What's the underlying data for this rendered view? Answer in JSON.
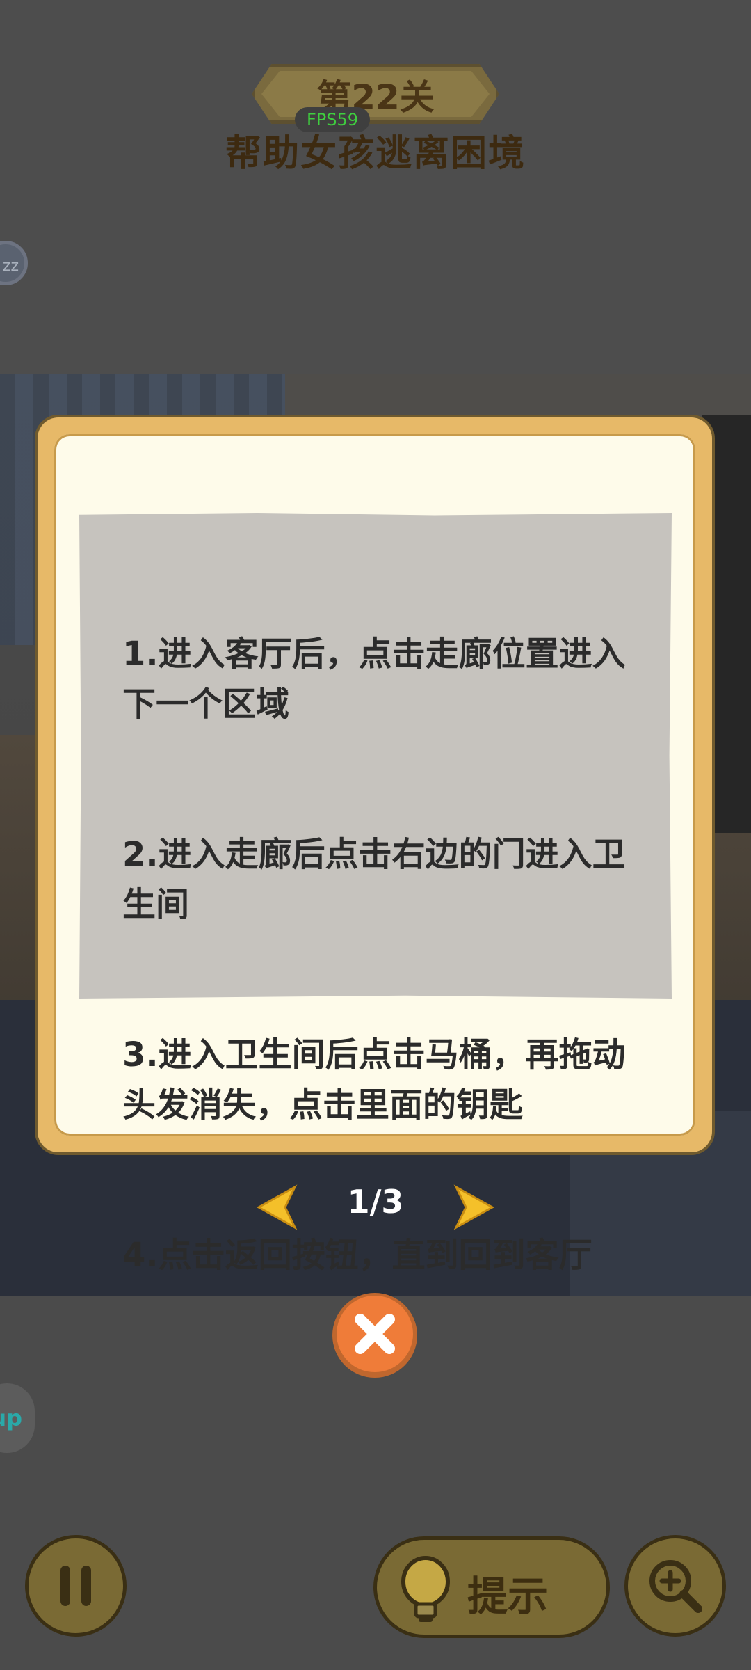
{
  "header": {
    "level": "第22关",
    "fps": "FPS59",
    "subtitle": "帮助女孩逃离困境"
  },
  "side": {
    "sleep_badge": "zz",
    "app_badge": "up"
  },
  "dialog": {
    "lines": [
      "1.进入客厅后，点击走廊位置进入下一个区域",
      "2.进入走廊后点击右边的门进入卫生间",
      "3.进入卫生间后点击马桶，再拖动头发消失，点击里面的钥匙",
      "4.点击返回按钮，直到回到客厅"
    ],
    "page_indicator": "1/3"
  },
  "toolbar": {
    "hint_label": "提示"
  },
  "icons": {
    "prev": "chevron-left-icon",
    "next": "chevron-right-icon",
    "close": "close-icon",
    "pause": "pause-icon",
    "hint": "lightbulb-icon",
    "zoom": "zoom-in-icon"
  },
  "colors": {
    "arrow": "#f4c02a",
    "close_button": "#ef7c39",
    "dialog_frame": "#e7b968",
    "dialog_bg": "#fefbea",
    "note_bg": "#c6c3be"
  }
}
